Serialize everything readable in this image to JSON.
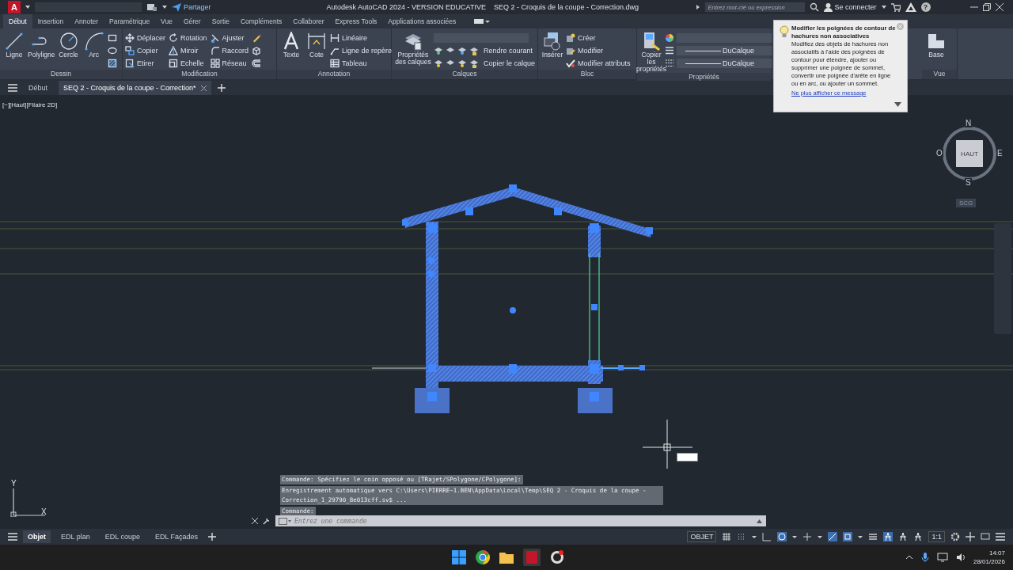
{
  "title_bar": {
    "app_logo": "A",
    "share": "Partager",
    "title": "Autodesk AutoCAD 2024 - VERSION EDUCATIVE    SEQ 2 - Croquis de la coupe - Correction.dwg",
    "search_placeholder": "Entrez mot-clé ou expression",
    "sign_in": "Se connecter",
    "help": "?"
  },
  "ribbon_tabs": [
    {
      "label": "Début",
      "selected": true
    },
    {
      "label": "Insertion",
      "selected": false
    },
    {
      "label": "Annoter",
      "selected": false
    },
    {
      "label": "Paramétrique",
      "selected": false
    },
    {
      "label": "Vue",
      "selected": false
    },
    {
      "label": "Gérer",
      "selected": false
    },
    {
      "label": "Sortie",
      "selected": false
    },
    {
      "label": "Compléments",
      "selected": false
    },
    {
      "label": "Collaborer",
      "selected": false
    },
    {
      "label": "Express Tools",
      "selected": false
    },
    {
      "label": "Applications associées",
      "selected": false
    }
  ],
  "ribbon_panels": [
    {
      "title": "Dessin",
      "tools": [
        {
          "kind": "large",
          "label": "Ligne"
        },
        {
          "kind": "large",
          "label": "Polyligne"
        },
        {
          "kind": "large",
          "label": "Cercle"
        },
        {
          "kind": "large",
          "label": "Arc"
        },
        {
          "kind": "icon"
        },
        {
          "kind": "icon"
        },
        {
          "kind": "icon"
        }
      ]
    },
    {
      "title": "Modification",
      "tools": [
        {
          "kind": "small",
          "label": "Déplacer"
        },
        {
          "kind": "small",
          "label": "Copier"
        },
        {
          "kind": "small",
          "label": "Etirer"
        },
        {
          "kind": "small",
          "label": "Rotation"
        },
        {
          "kind": "small",
          "label": "Miroir"
        },
        {
          "kind": "small",
          "label": "Echelle"
        },
        {
          "kind": "small",
          "label": "Ajuster"
        },
        {
          "kind": "small",
          "label": "Raccord"
        },
        {
          "kind": "small",
          "label": "Réseau"
        },
        {
          "kind": "icon"
        },
        {
          "kind": "icon"
        },
        {
          "kind": "icon"
        }
      ]
    },
    {
      "title": "Annotation",
      "tools": [
        {
          "kind": "large",
          "label": "Texte"
        },
        {
          "kind": "large",
          "label": "Cote"
        },
        {
          "kind": "small",
          "label": "Linéaire"
        },
        {
          "kind": "small",
          "label": "Ligne de repère"
        },
        {
          "kind": "small",
          "label": "Tableau"
        }
      ]
    },
    {
      "title": "Calques",
      "tools": [
        {
          "kind": "large",
          "label": "Propriétés des calques"
        },
        {
          "kind": "dropdown"
        },
        {
          "kind": "small",
          "label": "Rendre courant"
        },
        {
          "kind": "small",
          "label": "Copier le calque"
        }
      ]
    },
    {
      "title": "Bloc",
      "tools": [
        {
          "kind": "large",
          "label": "Insérer"
        },
        {
          "kind": "small",
          "label": "Créer"
        },
        {
          "kind": "small",
          "label": "Modifier"
        },
        {
          "kind": "small",
          "label": "Modifier attributs"
        }
      ]
    },
    {
      "title": "Propriétés",
      "tools": [
        {
          "kind": "large",
          "label": "Copier les propriétés"
        },
        {
          "kind": "dropdown"
        },
        {
          "kind": "dropdown",
          "value": "DuCalque"
        },
        {
          "kind": "dropdown",
          "value": "DuCalque"
        }
      ]
    },
    {
      "title": "Vue",
      "tools": [
        {
          "kind": "large",
          "label": "Base"
        }
      ]
    }
  ],
  "tooltip": {
    "title": "Modifier les poignées de contour de hachures non associatives",
    "body": "Modifiez des objets de hachures non associatifs à l'aide des poignées de contour pour étendre, ajouter ou supprimer une poignée de sommet, convertir une poignée d'arête en ligne ou en arc, ou ajouter un sommet.",
    "link": "Ne plus afficher ce message"
  },
  "document_tabs": [
    {
      "label": "Début",
      "selected": false
    },
    {
      "label": "SEQ 2 - Croquis de la coupe - Correction*",
      "selected": true
    }
  ],
  "viewport_label": "[−][Haut][Filaire 2D]",
  "view_cube": {
    "top": "HAUT",
    "north": "N",
    "south": "S",
    "east": "E",
    "west": "O",
    "ucs": "SCG"
  },
  "ucs_icon": {
    "x": "X",
    "y": "Y"
  },
  "command_line": {
    "history": [
      "Commande: Spécifiez le coin opposé ou [TRajet/SPolygone/CPolygone]:",
      "Enregistrement automatique vers C:\\Users\\PIERRE~1.BEN\\AppData\\Local\\Temp\\SEQ 2 - Croquis de la coupe - Correction_1_29790_8e013cff.sv$ ...",
      "Commande:"
    ],
    "placeholder": "Entrez une commande"
  },
  "layout_tabs": [
    {
      "label": "Objet",
      "selected": true
    },
    {
      "label": "EDL plan",
      "selected": false
    },
    {
      "label": "EDL coupe",
      "selected": false
    },
    {
      "label": "EDL Façades",
      "selected": false
    }
  ],
  "status_bar": {
    "model": "OBJET",
    "scale": "1:1"
  },
  "taskbar": {
    "time": "14:07",
    "date": "28/01/2026"
  }
}
